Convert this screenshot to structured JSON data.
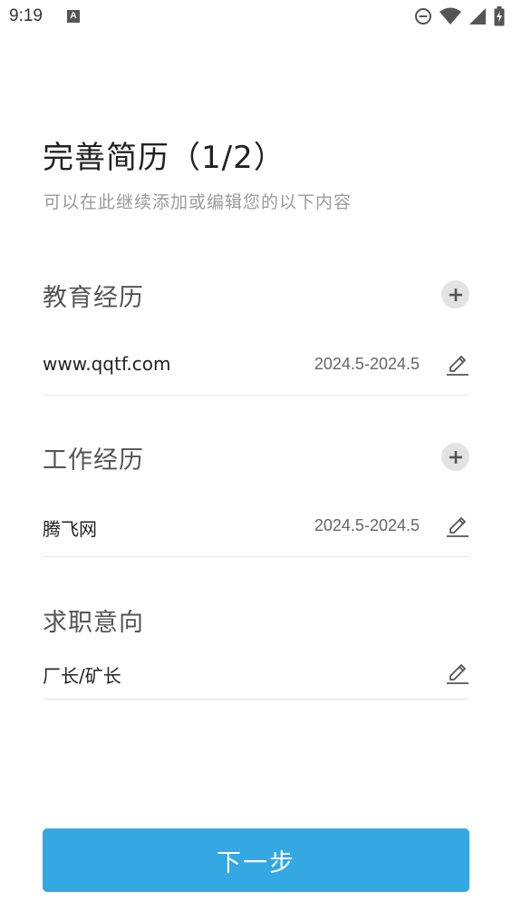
{
  "status_bar": {
    "time": "9:19",
    "notification_icon": "a-icon",
    "icons": [
      "dnd-icon",
      "wifi-icon",
      "signal-icon",
      "battery-charging-icon"
    ]
  },
  "header": {
    "title": "完善简历（1/2）",
    "subtitle": "可以在此继续添加或编辑您的以下内容"
  },
  "education": {
    "title": "教育经历",
    "items": [
      {
        "name": "www.qqtf.com",
        "date": "2024.5-2024.5"
      }
    ]
  },
  "work": {
    "title": "工作经历",
    "items": [
      {
        "name": "腾飞网",
        "date": "2024.5-2024.5"
      }
    ]
  },
  "intention": {
    "title": "求职意向",
    "value": "厂长/矿长"
  },
  "footer": {
    "next_label": "下一步"
  },
  "colors": {
    "primary": "#33a8e3",
    "add_button_bg": "#e3e3e3",
    "divider": "#e6e6e6"
  }
}
